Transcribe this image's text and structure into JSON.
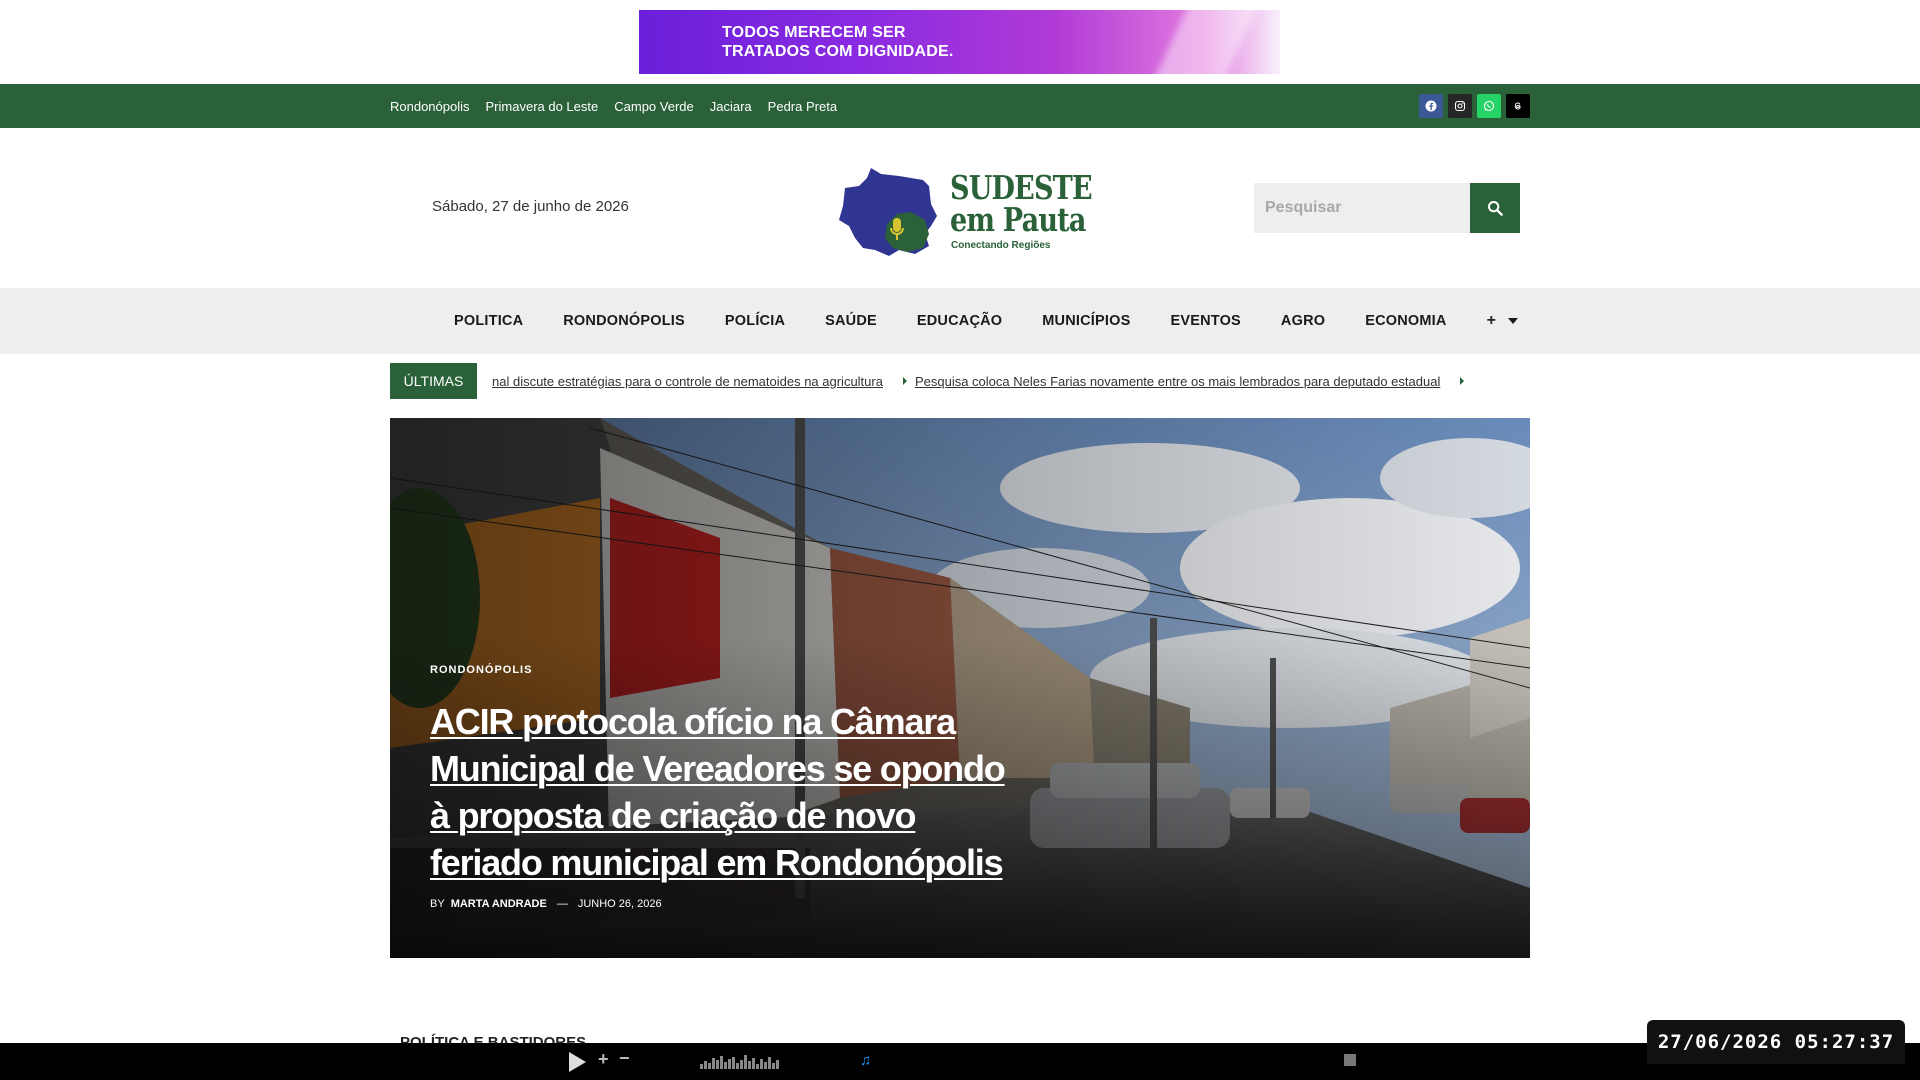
{
  "ad": {
    "line1": "TODOS MERECEM SER",
    "line2": "TRATADOS COM DIGNIDADE."
  },
  "topbar": {
    "cities": [
      "Rondonópolis",
      "Primavera do Leste",
      "Campo Verde",
      "Jaciara",
      "Pedra Preta"
    ],
    "socials": [
      "facebook-icon",
      "instagram-icon",
      "whatsapp-icon",
      "threads-icon"
    ]
  },
  "header": {
    "date": "Sábado, 27 de junho de 2026",
    "logo_line1": "SUDESTE",
    "logo_line2": "em Pauta",
    "logo_tagline": "Conectando Regiões",
    "search_placeholder": "Pesquisar"
  },
  "nav": {
    "items": [
      "POLITICA",
      "RONDONÓPOLIS",
      "POLÍCIA",
      "SAÚDE",
      "EDUCAÇÃO",
      "MUNICÍPIOS",
      "EVENTOS",
      "AGRO",
      "ECONOMIA"
    ],
    "more": "+"
  },
  "ticker": {
    "label": "ÚLTIMAS",
    "items": [
      "nal discute estratégias para o controle de nematoides na agricultura",
      "Pesquisa coloca Neles Farias novamente entre os mais lembrados para deputado estadual"
    ]
  },
  "hero": {
    "category": "RONDONÓPOLIS",
    "title": "ACIR protocola ofício na Câmara Municipal de Vereadores se opondo à proposta de criação de novo feriado municipal em Rondonópolis",
    "by": "BY",
    "author": "MARTA ANDRADE",
    "dash": "—",
    "date": "JUNHO 26, 2026"
  },
  "section": {
    "peek": "POLÍTICA E BASTIDORES"
  },
  "player": {
    "plus": "+",
    "minus": "−",
    "note": "♫"
  },
  "clock": {
    "value": "27/06/2026 05:27:37"
  },
  "colors": {
    "brand_green": "#2a6138",
    "nav_bg": "#eeeeee"
  }
}
